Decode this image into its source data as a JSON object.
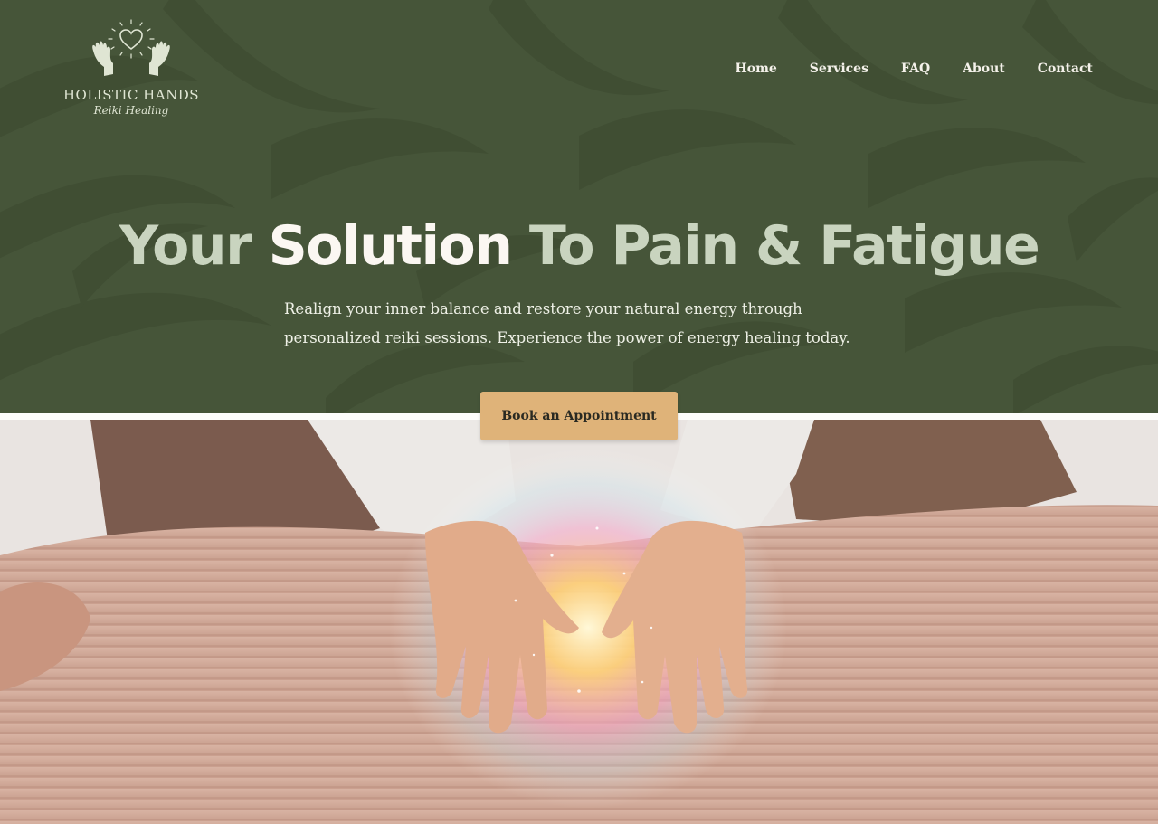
{
  "brand": {
    "name": "HOLISTIC HANDS",
    "tagline": "Reiki Healing"
  },
  "nav": {
    "items": [
      {
        "label": "Home"
      },
      {
        "label": "Services"
      },
      {
        "label": "FAQ"
      },
      {
        "label": "About"
      },
      {
        "label": "Contact"
      }
    ]
  },
  "hero": {
    "headline_part1": "Your ",
    "headline_part2": "Solution",
    "headline_part3": " To Pain & Fatigue",
    "subtext_line1": "Realign your inner balance and restore your natural energy through",
    "subtext_line2": "personalized reiki sessions. Experience the power of energy healing today.",
    "cta_label": "Book an Appointment"
  },
  "colors": {
    "hero_background": "#465539",
    "headline_muted": "#c9d4bf",
    "headline_bright": "#fbf7f2",
    "cta_background": "#dfb379"
  },
  "icons": {
    "logo": "hands-heart-icon",
    "photo": "reiki-hands-glow-photo"
  }
}
